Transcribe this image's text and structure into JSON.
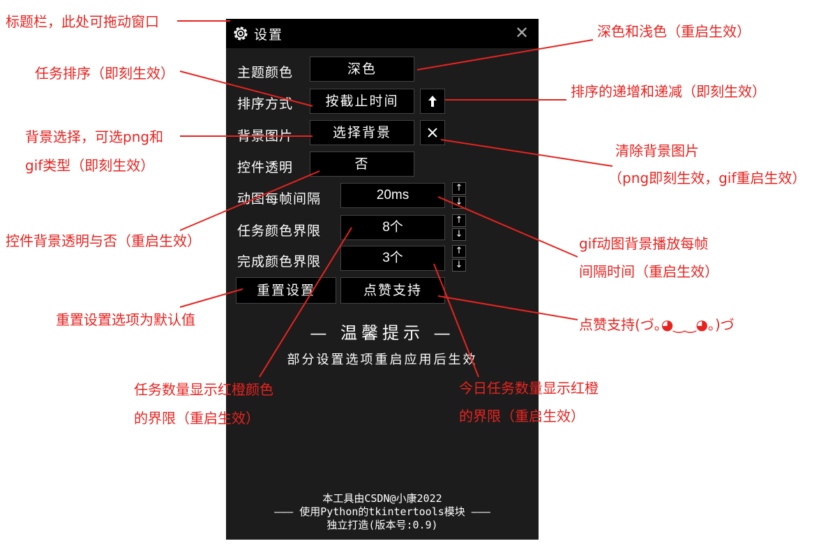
{
  "window": {
    "title": "设置",
    "theme_label": "主题颜色",
    "theme_value": "深色",
    "sort_label": "排序方式",
    "sort_value": "按截止时间",
    "sort_dir_icon": "arrow-up-icon",
    "bg_label": "背景图片",
    "bg_value": "选择背景",
    "transparent_label": "控件透明",
    "transparent_value": "否",
    "gif_interval_label": "动图每帧间隔",
    "gif_interval_value": "20ms",
    "task_limit_label": "任务颜色界限",
    "task_limit_value": "8个",
    "done_limit_label": "完成颜色界限",
    "done_limit_value": "3个",
    "reset_button": "重置设置",
    "like_button": "点赞支持",
    "tip_title": "— 温馨提示 —",
    "tip_text": "部分设置选项重启应用后生效",
    "footer_line1": "本工具由CSDN@小康2022",
    "footer_line2": "——— 使用Python的tkintertools模块 ———",
    "footer_line3": "独立打造(版本号:0.9)"
  },
  "annotations": {
    "titlebar": "标题栏，此处可拖动窗口",
    "theme": "深色和浅色（重启生效）",
    "sort": "任务排序（即刻生效）",
    "sort_dir": "排序的递增和递减（即刻生效）",
    "bg_line1": "背景选择，可选png和",
    "bg_line2": "gif类型（即刻生效）",
    "clear_line1": "清除背景图片",
    "clear_line2": "（png即刻生效，gif重启生效）",
    "transparent": "控件背景透明与否（重启生效）",
    "gif_line1": "gif动图背景播放每帧",
    "gif_line2": "间隔时间（重启生效）",
    "reset": "重置设置选项为默认值",
    "like": "点赞支持(づ｡◕‿‿◕｡)づ",
    "task_line1": "任务数量显示红橙颜色",
    "task_line2": "的界限（重启生效）",
    "done_line1": "今日任务数量显示红橙",
    "done_line2": "的界限（重启生效）"
  },
  "colors": {
    "annotation": "#e8231f",
    "window_bg": "#1c1c1c",
    "titlebar_bg": "#000000"
  }
}
